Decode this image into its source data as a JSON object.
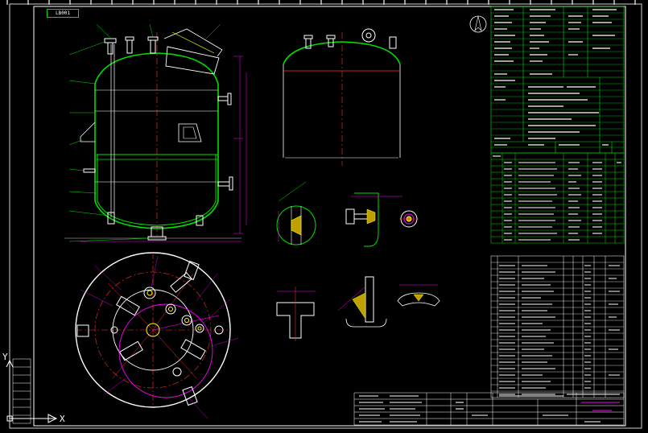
{
  "tab": {
    "label": "LB001"
  },
  "ucs": {
    "x_label": "X",
    "y_label": "Y"
  },
  "colors": {
    "background": "#000000",
    "frame": "#ffffff",
    "outline": "#00e000",
    "centerline": "#ff3030",
    "dimension": "#ff00ff",
    "hatch": "#ffff00",
    "leader": "#00c0c0"
  },
  "icons": [
    "north-arrow-icon",
    "ucs-axis-icon"
  ]
}
